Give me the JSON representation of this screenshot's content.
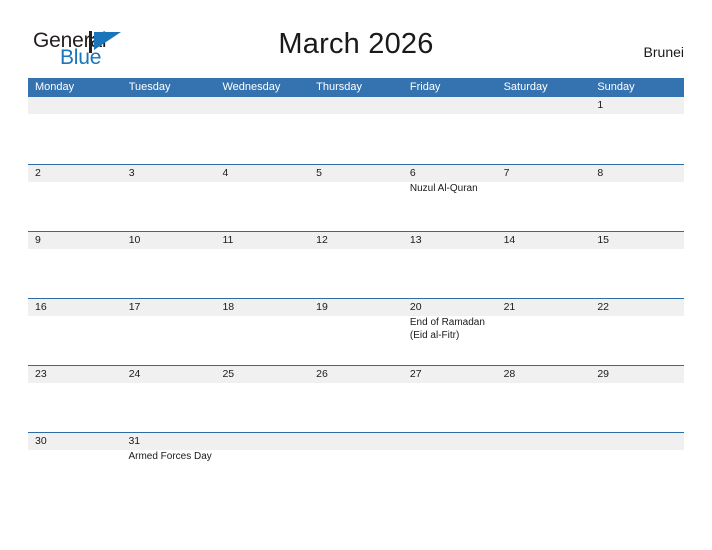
{
  "brand": {
    "name_part1": "General",
    "name_part2": "Blue",
    "mark": "flag-triangle-icon",
    "color_dark": "#231f20",
    "color_blue": "#1b75bb"
  },
  "header": {
    "title": "March 2026",
    "country": "Brunei"
  },
  "theme": {
    "header_blue": "#3573b0",
    "rule_blue": "#2e6da4",
    "band_gray": "#f0f0f0",
    "text": "#1a1a1a"
  },
  "calendar": {
    "weekday_headers": [
      "Monday",
      "Tuesday",
      "Wednesday",
      "Thursday",
      "Friday",
      "Saturday",
      "Sunday"
    ],
    "weeks": [
      {
        "days": [
          {
            "num": "",
            "events": []
          },
          {
            "num": "",
            "events": []
          },
          {
            "num": "",
            "events": []
          },
          {
            "num": "",
            "events": []
          },
          {
            "num": "",
            "events": []
          },
          {
            "num": "",
            "events": []
          },
          {
            "num": "1",
            "events": []
          }
        ]
      },
      {
        "days": [
          {
            "num": "2",
            "events": []
          },
          {
            "num": "3",
            "events": []
          },
          {
            "num": "4",
            "events": []
          },
          {
            "num": "5",
            "events": []
          },
          {
            "num": "6",
            "events": [
              "Nuzul Al-Quran"
            ]
          },
          {
            "num": "7",
            "events": []
          },
          {
            "num": "8",
            "events": []
          }
        ]
      },
      {
        "days": [
          {
            "num": "9",
            "events": []
          },
          {
            "num": "10",
            "events": []
          },
          {
            "num": "11",
            "events": []
          },
          {
            "num": "12",
            "events": []
          },
          {
            "num": "13",
            "events": []
          },
          {
            "num": "14",
            "events": []
          },
          {
            "num": "15",
            "events": []
          }
        ]
      },
      {
        "days": [
          {
            "num": "16",
            "events": []
          },
          {
            "num": "17",
            "events": []
          },
          {
            "num": "18",
            "events": []
          },
          {
            "num": "19",
            "events": []
          },
          {
            "num": "20",
            "events": [
              "End of Ramadan",
              "(Eid al-Fitr)"
            ]
          },
          {
            "num": "21",
            "events": []
          },
          {
            "num": "22",
            "events": []
          }
        ]
      },
      {
        "days": [
          {
            "num": "23",
            "events": []
          },
          {
            "num": "24",
            "events": []
          },
          {
            "num": "25",
            "events": []
          },
          {
            "num": "26",
            "events": []
          },
          {
            "num": "27",
            "events": []
          },
          {
            "num": "28",
            "events": []
          },
          {
            "num": "29",
            "events": []
          }
        ]
      },
      {
        "days": [
          {
            "num": "30",
            "events": []
          },
          {
            "num": "31",
            "events": [
              "Armed Forces Day"
            ]
          },
          {
            "num": "",
            "events": []
          },
          {
            "num": "",
            "events": []
          },
          {
            "num": "",
            "events": []
          },
          {
            "num": "",
            "events": []
          },
          {
            "num": "",
            "events": []
          }
        ]
      }
    ]
  }
}
